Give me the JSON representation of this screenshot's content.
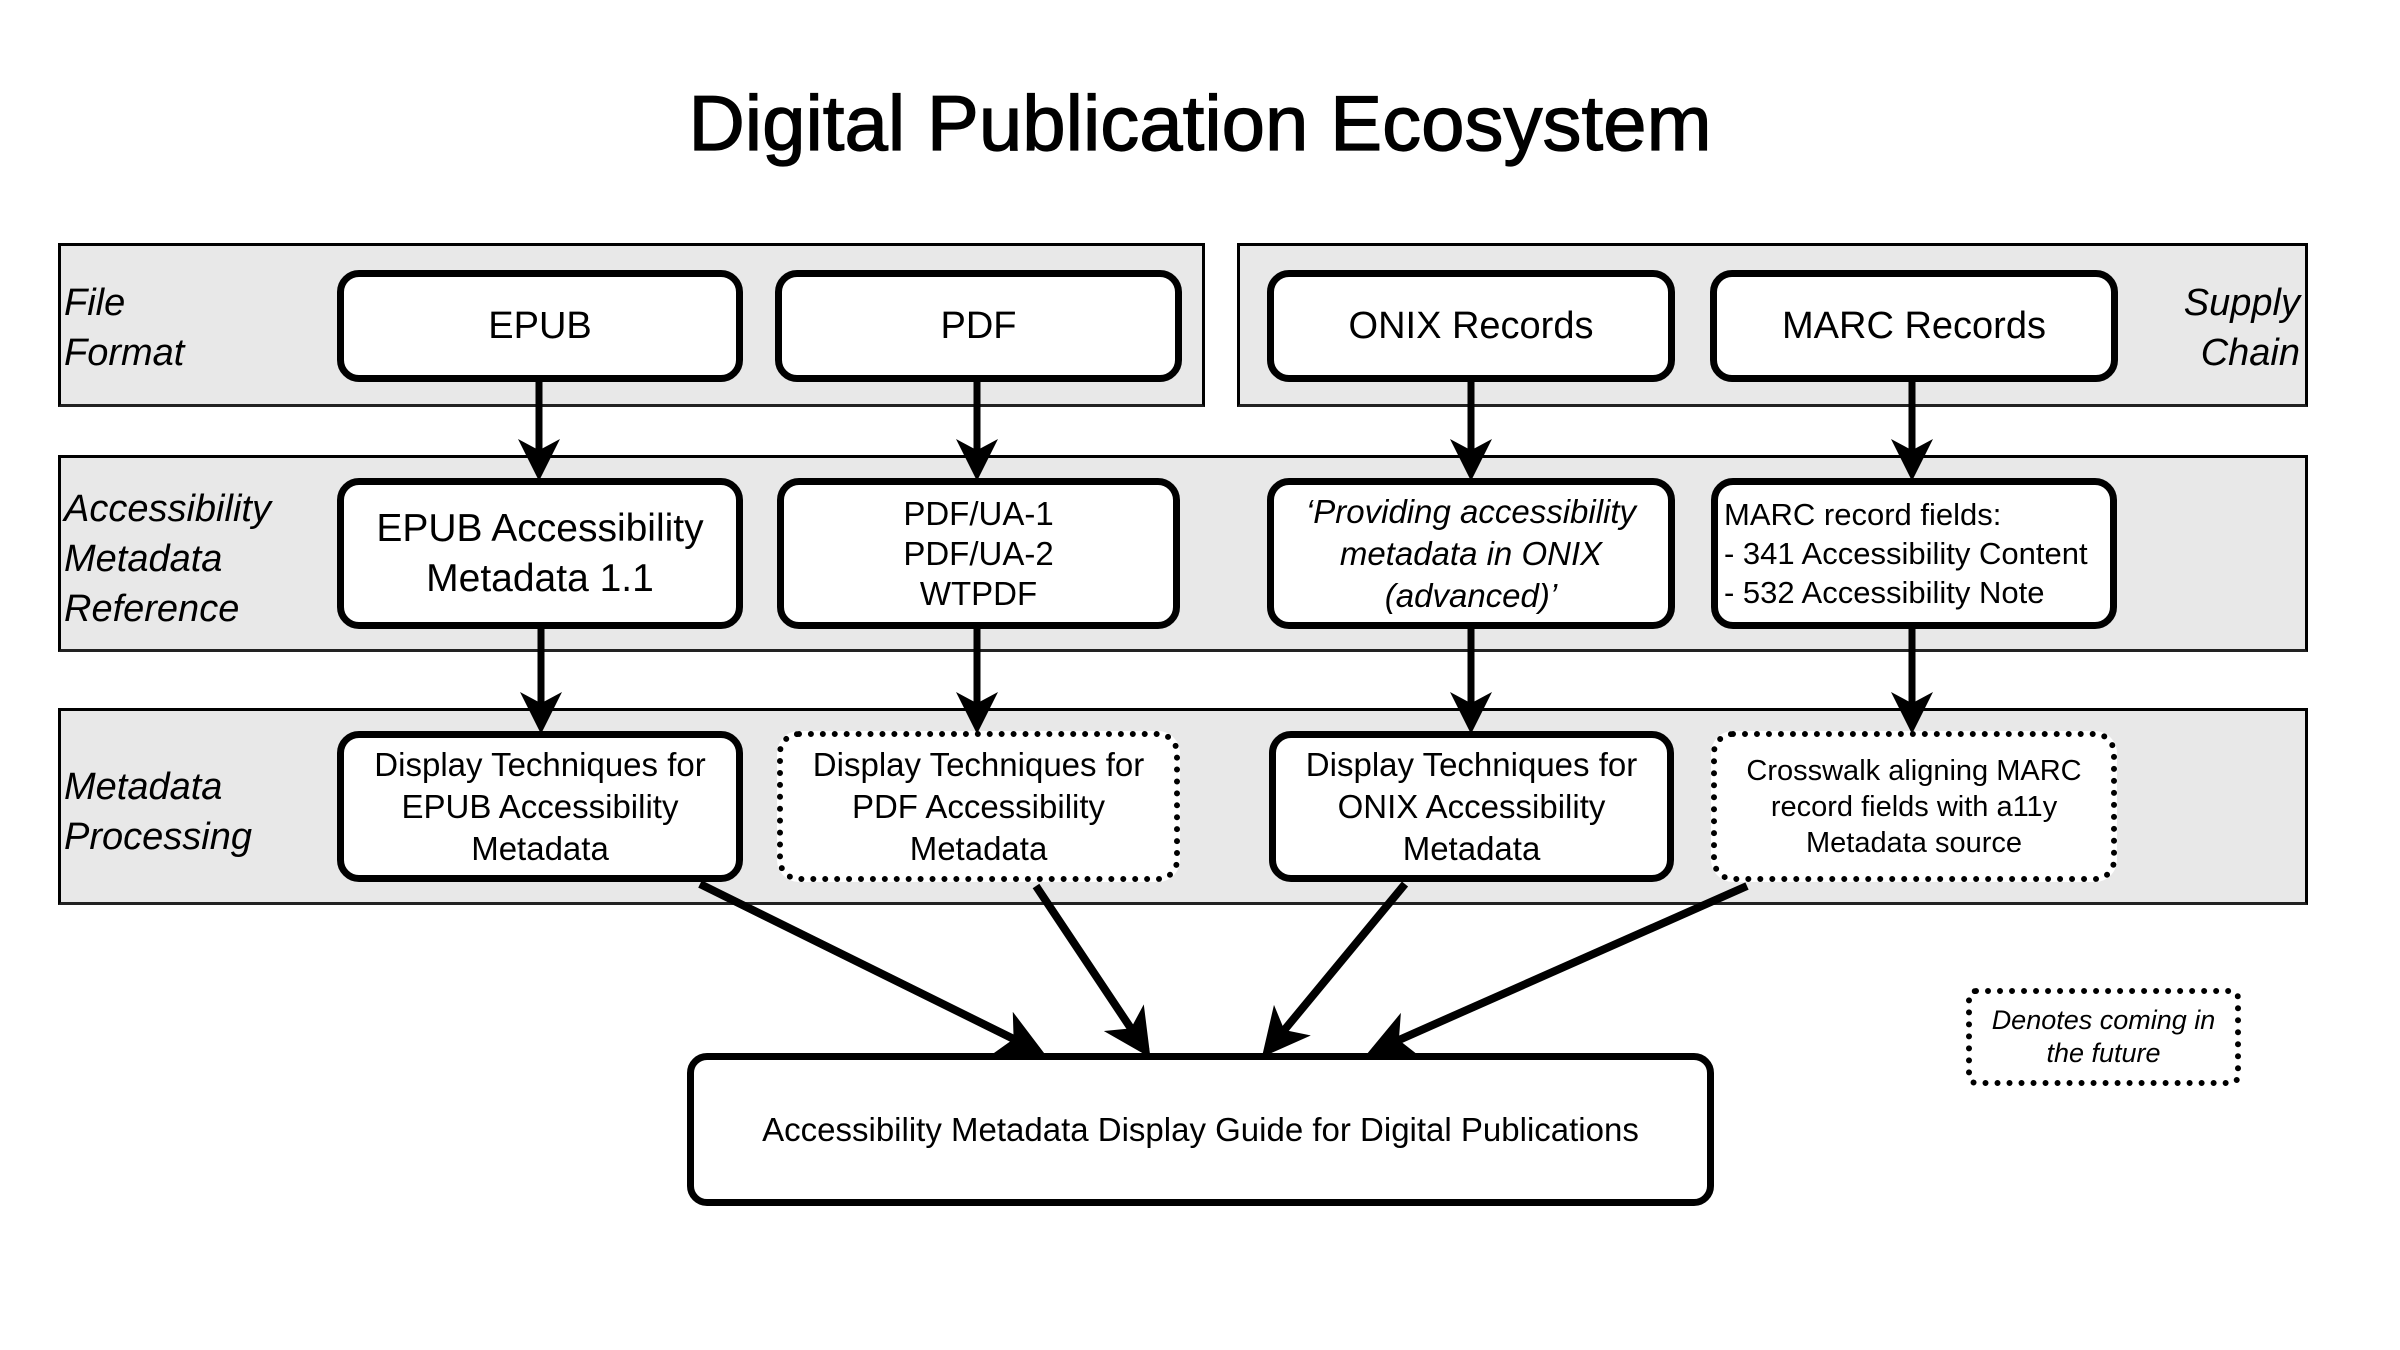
{
  "title": "Digital Publication Ecosystem",
  "rows": {
    "file_format": {
      "label": "File\nFormat",
      "side_label": "Supply\nChain"
    },
    "reference": {
      "label": "Accessibility\nMetadata\nReference"
    },
    "processing": {
      "label": "Metadata\nProcessing"
    }
  },
  "nodes": {
    "epub": "EPUB",
    "pdf": "PDF",
    "onix": "ONIX Records",
    "marc": "MARC Records",
    "epub_ref": "EPUB Accessibility\nMetadata 1.1",
    "pdf_ref": "PDF/UA-1\nPDF/UA-2\nWTPDF",
    "onix_ref": "‘Providing accessibility\nmetadata in ONIX\n(advanced)’",
    "marc_ref": "MARC record fields:\n- 341 Accessibility Content\n- 532 Accessibility Note",
    "epub_proc": "Display Techniques for\nEPUB Accessibility\nMetadata",
    "pdf_proc": "Display Techniques for\nPDF Accessibility\nMetadata",
    "onix_proc": "Display Techniques for\nONIX Accessibility\nMetadata",
    "marc_proc": "Crosswalk aligning MARC\nrecord fields with a11y\nMetadata source",
    "guide": "Accessibility Metadata Display Guide for Digital Publications"
  },
  "node_status": {
    "pdf_proc": "future",
    "marc_proc": "future"
  },
  "legend": {
    "text": "Denotes coming in\nthe future"
  },
  "edges": [
    [
      "epub",
      "epub_ref"
    ],
    [
      "pdf",
      "pdf_ref"
    ],
    [
      "onix",
      "onix_ref"
    ],
    [
      "marc",
      "marc_ref"
    ],
    [
      "epub_ref",
      "epub_proc"
    ],
    [
      "pdf_ref",
      "pdf_proc"
    ],
    [
      "onix_ref",
      "onix_proc"
    ],
    [
      "marc_ref",
      "marc_proc"
    ],
    [
      "epub_proc",
      "guide"
    ],
    [
      "pdf_proc",
      "guide"
    ],
    [
      "onix_proc",
      "guide"
    ],
    [
      "marc_proc",
      "guide"
    ]
  ]
}
